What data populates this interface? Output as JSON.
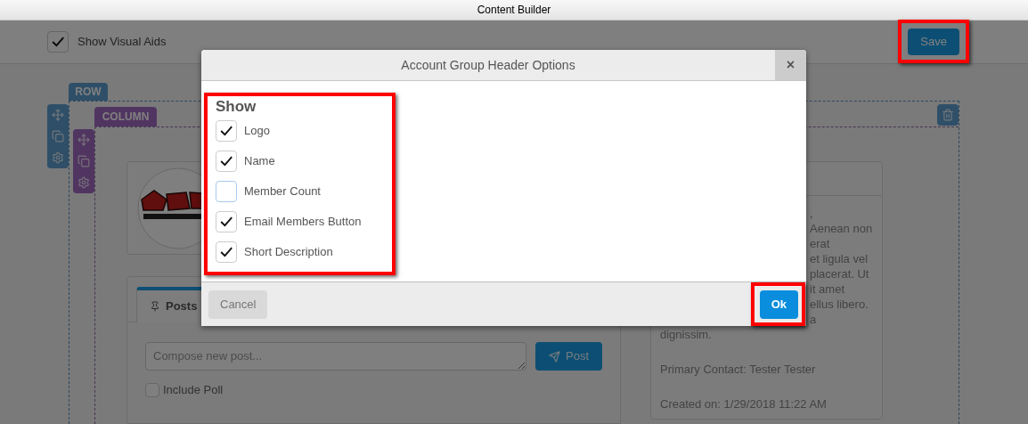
{
  "window": {
    "title": "Content Builder"
  },
  "toolbar": {
    "visual_aids": {
      "label": "Show Visual Aids",
      "checked": true
    },
    "save_button": {
      "label": "Save",
      "highlighted": true
    }
  },
  "builder": {
    "row_tag": "ROW",
    "column_tag": "COLUMN",
    "posts_panel": {
      "tab": {
        "label": "Posts",
        "selected": true
      },
      "compose": {
        "placeholder": "Compose new post..."
      },
      "post_button": "Post",
      "include_poll": {
        "label": "Include Poll",
        "checked": false
      }
    },
    "details_card": {
      "description_lines": [
        ",",
        "Aenean non",
        "erat",
        "et ligula vel",
        "placerat. Ut",
        "it amet",
        "ellus libero.",
        "a"
      ],
      "description_end": "dignissim.",
      "primary_contact": "Primary Contact: Tester Tester",
      "created_on": "Created on: 1/29/2018 11:22 AM"
    }
  },
  "dialog": {
    "title": "Account Group Header Options",
    "close": "×",
    "section": {
      "title": "Show",
      "highlighted": true,
      "options": [
        {
          "label": "Logo",
          "checked": true
        },
        {
          "label": "Name",
          "checked": true
        },
        {
          "label": "Member Count",
          "checked": false
        },
        {
          "label": "Email Members Button",
          "checked": true
        },
        {
          "label": "Short Description",
          "checked": true
        }
      ]
    },
    "cancel_button": "Cancel",
    "ok_button": {
      "label": "Ok",
      "highlighted": true
    }
  }
}
